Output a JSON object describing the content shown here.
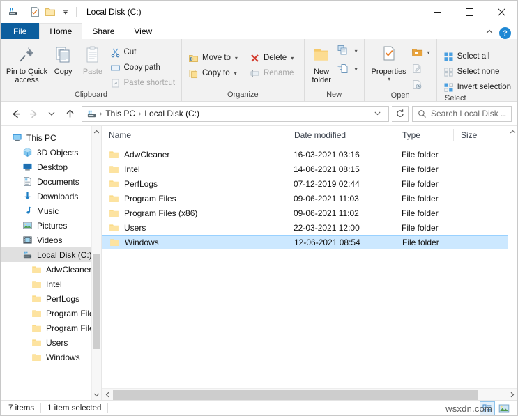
{
  "window": {
    "title": "Local Disk (C:)",
    "quick_access": [
      {
        "name": "drive-icon",
        "label": "Local Disk properties"
      },
      {
        "name": "properties-icon",
        "label": "Properties"
      },
      {
        "name": "new-folder-icon",
        "label": "New folder"
      },
      {
        "name": "chevron-down-icon",
        "label": "Customize Quick Access Toolbar"
      }
    ],
    "controls": {
      "minimize": "Minimize",
      "maximize": "Maximize",
      "close": "Close"
    }
  },
  "tabs": [
    {
      "label": "File",
      "id": "file"
    },
    {
      "label": "Home",
      "id": "home"
    },
    {
      "label": "Share",
      "id": "share"
    },
    {
      "label": "View",
      "id": "view"
    }
  ],
  "tabbar_right": {
    "collapse_label": "Minimize the Ribbon",
    "help_label": "?"
  },
  "ribbon": {
    "groups": [
      {
        "label": "Clipboard",
        "big_buttons": [
          {
            "name": "pin-to-quick-access-button",
            "label": "Pin to Quick\naccess",
            "line1": "Pin to Quick",
            "line2": "access",
            "disabled": false
          },
          {
            "name": "copy-button",
            "label": "Copy",
            "line1": "Copy",
            "line2": "",
            "disabled": false
          },
          {
            "name": "paste-button",
            "label": "Paste",
            "line1": "Paste",
            "line2": "",
            "disabled": true
          }
        ],
        "small_buttons": [
          {
            "name": "cut-button",
            "label": "Cut",
            "disabled": false
          },
          {
            "name": "copy-path-button",
            "label": "Copy path",
            "disabled": false
          },
          {
            "name": "paste-shortcut-button",
            "label": "Paste shortcut",
            "disabled": true
          }
        ]
      },
      {
        "label": "Organize",
        "small_buttons": [
          {
            "name": "move-to-button",
            "label": "Move to",
            "disabled": false,
            "caret": true
          },
          {
            "name": "copy-to-button",
            "label": "Copy to",
            "disabled": false,
            "caret": true
          },
          {
            "name": "delete-button",
            "label": "Delete",
            "disabled": false,
            "caret": true
          },
          {
            "name": "rename-button",
            "label": "Rename",
            "disabled": true,
            "caret": false
          }
        ]
      },
      {
        "label": "New",
        "big_buttons": [
          {
            "name": "new-folder-button",
            "line1": "New",
            "line2": "folder"
          }
        ],
        "small_buttons": [
          {
            "name": "new-item-button",
            "label": "New item"
          },
          {
            "name": "easy-access-button",
            "label": "Easy access"
          }
        ]
      },
      {
        "label": "Open",
        "big_buttons": [
          {
            "name": "properties-button",
            "line1": "Properties",
            "line2": ""
          }
        ],
        "small_buttons": [
          {
            "name": "open-button",
            "label": "Open"
          },
          {
            "name": "edit-button",
            "label": "Edit"
          },
          {
            "name": "history-button",
            "label": "History"
          }
        ]
      },
      {
        "label": "Select",
        "small_buttons": [
          {
            "name": "select-all-button",
            "label": "Select all",
            "disabled": false
          },
          {
            "name": "select-none-button",
            "label": "Select none",
            "disabled": false
          },
          {
            "name": "invert-selection-button",
            "label": "Invert selection",
            "disabled": false
          }
        ]
      }
    ]
  },
  "address": {
    "back_label": "Back",
    "forward_label": "Forward",
    "recent_label": "Recent locations",
    "up_label": "Up",
    "breadcrumbs": [
      "This PC",
      "Local Disk (C:)"
    ],
    "separator": "›",
    "refresh_label": "Refresh",
    "dropdown_label": "Previous locations"
  },
  "search": {
    "placeholder": "Search Local Disk ...",
    "icon": "search-icon"
  },
  "nav_pane": {
    "items": [
      {
        "label": "This PC",
        "icon": "pc-icon",
        "indent": 0,
        "selected": false
      },
      {
        "label": "3D Objects",
        "icon": "3d-objects-icon",
        "indent": 1,
        "selected": false
      },
      {
        "label": "Desktop",
        "icon": "desktop-icon",
        "indent": 1,
        "selected": false
      },
      {
        "label": "Documents",
        "icon": "documents-icon",
        "indent": 1,
        "selected": false
      },
      {
        "label": "Downloads",
        "icon": "downloads-icon",
        "indent": 1,
        "selected": false
      },
      {
        "label": "Music",
        "icon": "music-icon",
        "indent": 1,
        "selected": false
      },
      {
        "label": "Pictures",
        "icon": "pictures-icon",
        "indent": 1,
        "selected": false
      },
      {
        "label": "Videos",
        "icon": "videos-icon",
        "indent": 1,
        "selected": false
      },
      {
        "label": "Local Disk (C:)",
        "icon": "drive-icon",
        "indent": 1,
        "selected": true
      },
      {
        "label": "AdwCleaner",
        "icon": "folder-icon",
        "indent": 2,
        "selected": false
      },
      {
        "label": "Intel",
        "icon": "folder-icon",
        "indent": 2,
        "selected": false
      },
      {
        "label": "PerfLogs",
        "icon": "folder-icon",
        "indent": 2,
        "selected": false
      },
      {
        "label": "Program Files",
        "icon": "folder-icon",
        "indent": 2,
        "selected": false
      },
      {
        "label": "Program Files (",
        "icon": "folder-icon",
        "indent": 2,
        "selected": false
      },
      {
        "label": "Users",
        "icon": "folder-icon",
        "indent": 2,
        "selected": false
      },
      {
        "label": "Windows",
        "icon": "folder-icon",
        "indent": 2,
        "selected": false
      }
    ]
  },
  "file_list": {
    "columns": [
      "Name",
      "Date modified",
      "Type",
      "Size"
    ],
    "rows": [
      {
        "name": "AdwCleaner",
        "date": "16-03-2021 03:16",
        "type": "File folder",
        "size": "",
        "selected": false
      },
      {
        "name": "Intel",
        "date": "14-06-2021 08:15",
        "type": "File folder",
        "size": "",
        "selected": false
      },
      {
        "name": "PerfLogs",
        "date": "07-12-2019 02:44",
        "type": "File folder",
        "size": "",
        "selected": false
      },
      {
        "name": "Program Files",
        "date": "09-06-2021 11:03",
        "type": "File folder",
        "size": "",
        "selected": false
      },
      {
        "name": "Program Files (x86)",
        "date": "09-06-2021 11:02",
        "type": "File folder",
        "size": "",
        "selected": false
      },
      {
        "name": "Users",
        "date": "22-03-2021 12:00",
        "type": "File folder",
        "size": "",
        "selected": false
      },
      {
        "name": "Windows",
        "date": "12-06-2021 08:54",
        "type": "File folder",
        "size": "",
        "selected": true
      }
    ]
  },
  "status": {
    "item_count": "7 items",
    "selection": "1 item selected",
    "view_details_label": "Details view",
    "view_large_icons_label": "Large icons view"
  },
  "watermark": "wsxdn.com",
  "colors": {
    "file_tab": "#0c5e9e",
    "selection": "#cce8ff",
    "selection_border": "#99d1ff",
    "nav_selection": "#e0e0e0",
    "ribbon_bg": "#f2f2f2",
    "folder_yellow": "#ffd878",
    "help_blue": "#1f88d4"
  }
}
